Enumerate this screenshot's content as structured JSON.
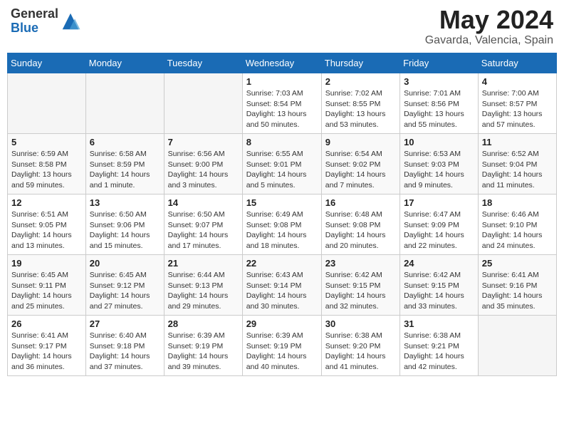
{
  "header": {
    "logo_general": "General",
    "logo_blue": "Blue",
    "month_year": "May 2024",
    "location": "Gavarda, Valencia, Spain"
  },
  "days_of_week": [
    "Sunday",
    "Monday",
    "Tuesday",
    "Wednesday",
    "Thursday",
    "Friday",
    "Saturday"
  ],
  "weeks": [
    [
      {
        "day": "",
        "info": ""
      },
      {
        "day": "",
        "info": ""
      },
      {
        "day": "",
        "info": ""
      },
      {
        "day": "1",
        "info": "Sunrise: 7:03 AM\nSunset: 8:54 PM\nDaylight: 13 hours\nand 50 minutes."
      },
      {
        "day": "2",
        "info": "Sunrise: 7:02 AM\nSunset: 8:55 PM\nDaylight: 13 hours\nand 53 minutes."
      },
      {
        "day": "3",
        "info": "Sunrise: 7:01 AM\nSunset: 8:56 PM\nDaylight: 13 hours\nand 55 minutes."
      },
      {
        "day": "4",
        "info": "Sunrise: 7:00 AM\nSunset: 8:57 PM\nDaylight: 13 hours\nand 57 minutes."
      }
    ],
    [
      {
        "day": "5",
        "info": "Sunrise: 6:59 AM\nSunset: 8:58 PM\nDaylight: 13 hours\nand 59 minutes."
      },
      {
        "day": "6",
        "info": "Sunrise: 6:58 AM\nSunset: 8:59 PM\nDaylight: 14 hours\nand 1 minute."
      },
      {
        "day": "7",
        "info": "Sunrise: 6:56 AM\nSunset: 9:00 PM\nDaylight: 14 hours\nand 3 minutes."
      },
      {
        "day": "8",
        "info": "Sunrise: 6:55 AM\nSunset: 9:01 PM\nDaylight: 14 hours\nand 5 minutes."
      },
      {
        "day": "9",
        "info": "Sunrise: 6:54 AM\nSunset: 9:02 PM\nDaylight: 14 hours\nand 7 minutes."
      },
      {
        "day": "10",
        "info": "Sunrise: 6:53 AM\nSunset: 9:03 PM\nDaylight: 14 hours\nand 9 minutes."
      },
      {
        "day": "11",
        "info": "Sunrise: 6:52 AM\nSunset: 9:04 PM\nDaylight: 14 hours\nand 11 minutes."
      }
    ],
    [
      {
        "day": "12",
        "info": "Sunrise: 6:51 AM\nSunset: 9:05 PM\nDaylight: 14 hours\nand 13 minutes."
      },
      {
        "day": "13",
        "info": "Sunrise: 6:50 AM\nSunset: 9:06 PM\nDaylight: 14 hours\nand 15 minutes."
      },
      {
        "day": "14",
        "info": "Sunrise: 6:50 AM\nSunset: 9:07 PM\nDaylight: 14 hours\nand 17 minutes."
      },
      {
        "day": "15",
        "info": "Sunrise: 6:49 AM\nSunset: 9:08 PM\nDaylight: 14 hours\nand 18 minutes."
      },
      {
        "day": "16",
        "info": "Sunrise: 6:48 AM\nSunset: 9:08 PM\nDaylight: 14 hours\nand 20 minutes."
      },
      {
        "day": "17",
        "info": "Sunrise: 6:47 AM\nSunset: 9:09 PM\nDaylight: 14 hours\nand 22 minutes."
      },
      {
        "day": "18",
        "info": "Sunrise: 6:46 AM\nSunset: 9:10 PM\nDaylight: 14 hours\nand 24 minutes."
      }
    ],
    [
      {
        "day": "19",
        "info": "Sunrise: 6:45 AM\nSunset: 9:11 PM\nDaylight: 14 hours\nand 25 minutes."
      },
      {
        "day": "20",
        "info": "Sunrise: 6:45 AM\nSunset: 9:12 PM\nDaylight: 14 hours\nand 27 minutes."
      },
      {
        "day": "21",
        "info": "Sunrise: 6:44 AM\nSunset: 9:13 PM\nDaylight: 14 hours\nand 29 minutes."
      },
      {
        "day": "22",
        "info": "Sunrise: 6:43 AM\nSunset: 9:14 PM\nDaylight: 14 hours\nand 30 minutes."
      },
      {
        "day": "23",
        "info": "Sunrise: 6:42 AM\nSunset: 9:15 PM\nDaylight: 14 hours\nand 32 minutes."
      },
      {
        "day": "24",
        "info": "Sunrise: 6:42 AM\nSunset: 9:15 PM\nDaylight: 14 hours\nand 33 minutes."
      },
      {
        "day": "25",
        "info": "Sunrise: 6:41 AM\nSunset: 9:16 PM\nDaylight: 14 hours\nand 35 minutes."
      }
    ],
    [
      {
        "day": "26",
        "info": "Sunrise: 6:41 AM\nSunset: 9:17 PM\nDaylight: 14 hours\nand 36 minutes."
      },
      {
        "day": "27",
        "info": "Sunrise: 6:40 AM\nSunset: 9:18 PM\nDaylight: 14 hours\nand 37 minutes."
      },
      {
        "day": "28",
        "info": "Sunrise: 6:39 AM\nSunset: 9:19 PM\nDaylight: 14 hours\nand 39 minutes."
      },
      {
        "day": "29",
        "info": "Sunrise: 6:39 AM\nSunset: 9:19 PM\nDaylight: 14 hours\nand 40 minutes."
      },
      {
        "day": "30",
        "info": "Sunrise: 6:38 AM\nSunset: 9:20 PM\nDaylight: 14 hours\nand 41 minutes."
      },
      {
        "day": "31",
        "info": "Sunrise: 6:38 AM\nSunset: 9:21 PM\nDaylight: 14 hours\nand 42 minutes."
      },
      {
        "day": "",
        "info": ""
      }
    ]
  ]
}
